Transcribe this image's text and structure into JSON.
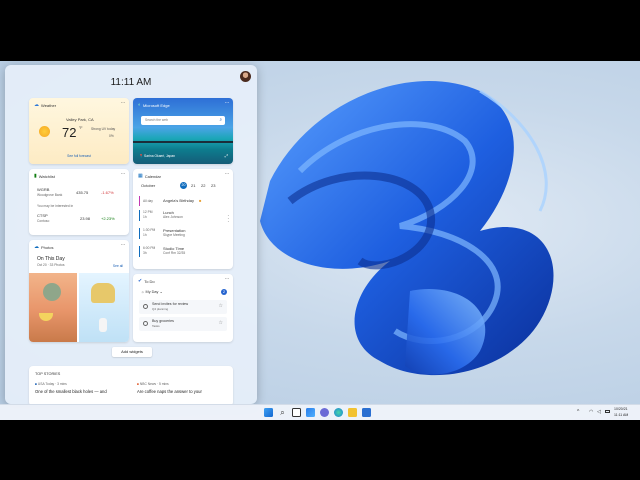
{
  "clock": "11:11 AM",
  "weather": {
    "title": "Weather",
    "location": "Valley Park, CA",
    "temp": "72",
    "unit": "°F",
    "condition": "Strong UV today",
    "precip": "0%",
    "link": "See full forecast"
  },
  "edge": {
    "title": "Microsoft Edge",
    "search_placeholder": "Search the web",
    "caption": "Sarina Okaeri, Japan"
  },
  "watchlist": {
    "title": "Watchlist",
    "stocks": [
      {
        "symbol": "WGRB",
        "name": "Woodgrove Bank",
        "price": "435.75",
        "change": "-1.67%",
        "color": "#d13438"
      },
      {
        "symbol": "CTSP",
        "name": "Contoso",
        "price": "23.98",
        "change": "+2.23%",
        "color": "#107c10"
      }
    ],
    "note": "You may be interested in"
  },
  "calendar": {
    "title": "Calendar",
    "month": "October",
    "days": [
      "20",
      "21",
      "22",
      "23"
    ],
    "events": [
      {
        "time": "All day",
        "duration": "",
        "title": "Angela's Birthday",
        "sub": "",
        "color": "#c239b3"
      },
      {
        "time": "12 PM",
        "duration": "1h",
        "title": "Lunch",
        "sub": "Alex  Johnson",
        "color": "#0f6cbd"
      },
      {
        "time": "1:30 PM",
        "duration": "1h",
        "title": "Presentation",
        "sub": "Skype Meeting",
        "color": "#0f6cbd"
      },
      {
        "time": "6:00 PM",
        "duration": "3h",
        "title": "Studio Time",
        "sub": "Conf Rm 32/35",
        "color": "#0f6cbd"
      }
    ]
  },
  "photos": {
    "title": "Photos",
    "heading": "On This Day",
    "date": "Oct 20 · 33 Photos",
    "see_all": "See all"
  },
  "todo": {
    "title": "To Do",
    "list": "My Day",
    "count": "2",
    "tasks": [
      {
        "title": "Send invites for review",
        "sub": "Q4 planning"
      },
      {
        "title": "Buy groceries",
        "sub": "Tasks"
      }
    ]
  },
  "add_widgets": "Add widgets",
  "top_stories": {
    "title": "TOP STORIES",
    "items": [
      {
        "source": "USA Today · 3 mins",
        "headline": "One of the smallest black holes — and"
      },
      {
        "source": "NBC News · 5 mins",
        "headline": "Are coffee naps the answer to your"
      }
    ]
  },
  "taskbar": {
    "date": "10/20/21",
    "time": "11:11 AM"
  }
}
